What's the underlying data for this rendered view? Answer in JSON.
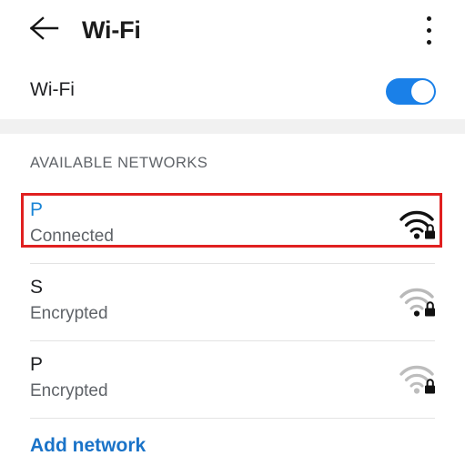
{
  "appbar": {
    "back_icon": "back-arrow-icon",
    "title": "Wi-Fi",
    "overflow_icon": "more-vertical-icon"
  },
  "wifi_toggle_row": {
    "label": "Wi-Fi",
    "state": "on",
    "accent_color": "#1a80e8"
  },
  "section": {
    "header": "AVAILABLE NETWORKS"
  },
  "networks": [
    {
      "ssid": "P",
      "status": "Connected",
      "ssid_color": "#1a85d6",
      "signal_icon": "wifi-lock-icon",
      "signal_strength": "full",
      "secured": true,
      "highlighted": true
    },
    {
      "ssid": "S",
      "status": "Encrypted",
      "ssid_color": "#202124",
      "signal_icon": "wifi-lock-icon",
      "signal_strength": "weak",
      "secured": true,
      "highlighted": false
    },
    {
      "ssid": "P",
      "status": "Encrypted",
      "ssid_color": "#202124",
      "signal_icon": "wifi-lock-icon",
      "signal_strength": "none",
      "secured": true,
      "highlighted": false
    }
  ],
  "footer": {
    "add_network_label": "Add network",
    "add_network_color": "#1a73c8"
  },
  "highlight": {
    "color": "#e02020"
  }
}
